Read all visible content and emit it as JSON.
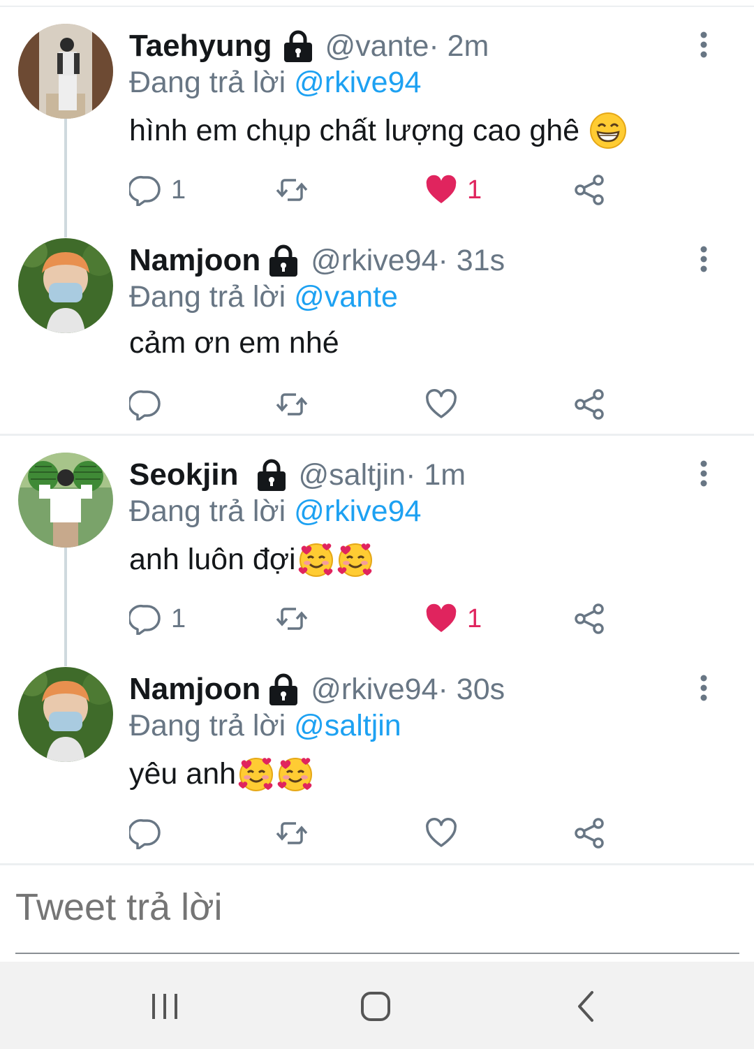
{
  "tweets": [
    {
      "name": "Taehyung",
      "handle": "@vante",
      "time": " · 2m",
      "reply_prefix": "Đang trả lời ",
      "reply_mention": "@rkive94",
      "text": "hình em chụp chất lượng cao ghê",
      "emoji": [
        "grinning-face-with-smiling-eyes"
      ],
      "reply_count": "1",
      "like_count": "1",
      "liked": true
    },
    {
      "name": "Namjoon",
      "handle": "@rkive94",
      "time": " · 31s",
      "reply_prefix": "Đang trả lời ",
      "reply_mention": "@vante",
      "text": "cảm ơn em nhé",
      "emoji": [],
      "reply_count": "",
      "like_count": "",
      "liked": false
    },
    {
      "name": "Seokjin",
      "handle": "@saltjin",
      "time": " · 1m",
      "reply_prefix": "Đang trả lời ",
      "reply_mention": "@rkive94",
      "text": "anh luôn đợi",
      "emoji": [
        "smiling-face-with-hearts",
        "smiling-face-with-hearts"
      ],
      "reply_count": "1",
      "like_count": "1",
      "liked": true
    },
    {
      "name": "Namjoon",
      "handle": "@rkive94",
      "time": " · 30s",
      "reply_prefix": "Đang trả lời ",
      "reply_mention": "@saltjin",
      "text": "yêu anh",
      "emoji": [
        "smiling-face-with-hearts",
        "smiling-face-with-hearts"
      ],
      "reply_count": "",
      "like_count": "",
      "liked": false
    }
  ],
  "compose": {
    "placeholder": "Tweet trả lời"
  },
  "navbar": {
    "icons": [
      "recent-apps-icon",
      "home-icon",
      "back-icon"
    ]
  },
  "colors": {
    "accent": "#1da1f2",
    "like": "#e0245e",
    "secondary_text": "#687684"
  }
}
